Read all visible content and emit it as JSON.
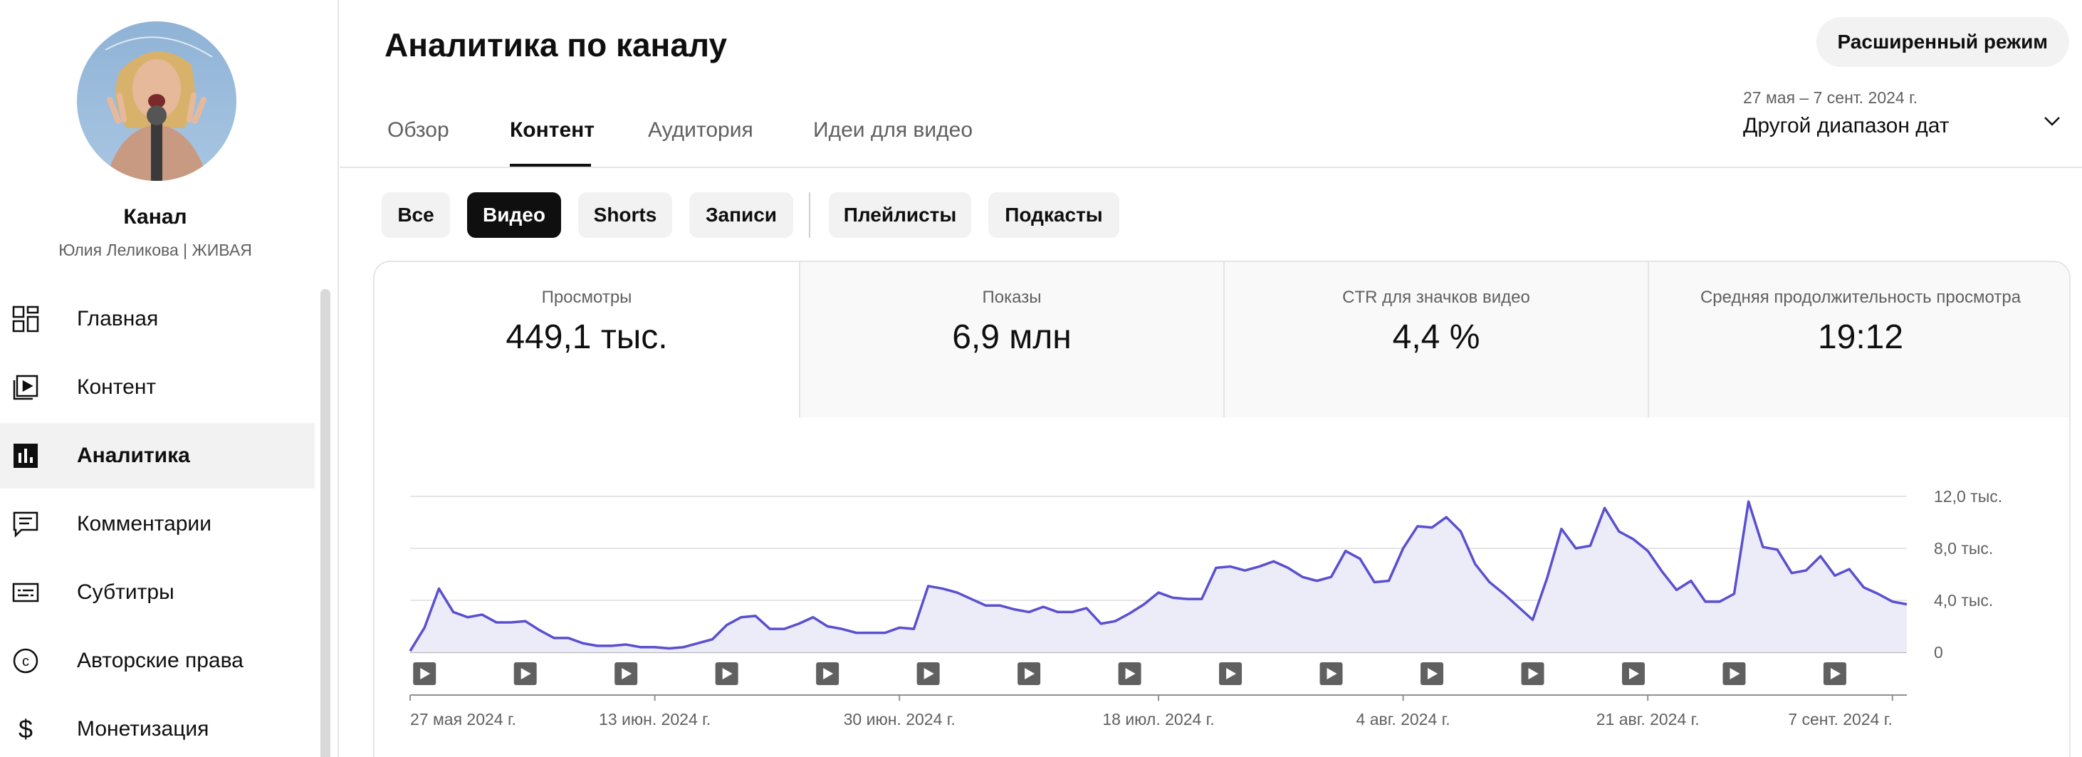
{
  "sidebar": {
    "channel_title": "Канал",
    "channel_name": "Юлия Леликова | ЖИВАЯ",
    "items": [
      {
        "label": "Главная",
        "icon": "dashboard-icon"
      },
      {
        "label": "Контент",
        "icon": "content-icon"
      },
      {
        "label": "Аналитика",
        "icon": "analytics-icon",
        "active": true
      },
      {
        "label": "Комментарии",
        "icon": "comments-icon"
      },
      {
        "label": "Субтитры",
        "icon": "subtitles-icon"
      },
      {
        "label": "Авторские права",
        "icon": "copyright-icon"
      },
      {
        "label": "Монетизация",
        "icon": "monetization-icon"
      }
    ]
  },
  "header": {
    "title": "Аналитика по каналу",
    "advanced_button": "Расширенный режим",
    "tabs": [
      {
        "label": "Обзор"
      },
      {
        "label": "Контент",
        "active": true
      },
      {
        "label": "Аудитория"
      },
      {
        "label": "Идеи для видео"
      }
    ],
    "date_range": {
      "subtitle": "27 мая – 7 сент. 2024 г.",
      "label": "Другой диапазон дат"
    }
  },
  "chips": [
    {
      "label": "Все"
    },
    {
      "label": "Видео",
      "active": true
    },
    {
      "label": "Shorts"
    },
    {
      "label": "Записи"
    },
    {
      "label": "Плейлисты"
    },
    {
      "label": "Подкасты"
    }
  ],
  "metrics": [
    {
      "label": "Просмотры",
      "value": "449,1 тыс.",
      "active": true
    },
    {
      "label": "Показы",
      "value": "6,9 млн"
    },
    {
      "label": "CTR для значков видео",
      "value": "4,4 %"
    },
    {
      "label": "Средняя продолжительность просмотра",
      "value": "19:12"
    }
  ],
  "colors": {
    "accent_line": "#5a4fcf",
    "fill": "#ecebf8"
  },
  "chart_data": {
    "type": "area",
    "y_tick_labels": [
      "12,0 тыс.",
      "8,0 тыс.",
      "4,0 тыс.",
      "0"
    ],
    "y_ticks": [
      12000,
      8000,
      4000,
      0
    ],
    "ylim": [
      0,
      12000
    ],
    "x_tick_labels": [
      "27 мая 2024 г.",
      "13 июн. 2024 г.",
      "30 июн. 2024 г.",
      "18 июл. 2024 г.",
      "4 авг. 2024 г.",
      "21 авг. 2024 г.",
      "7 сент. 2024 г."
    ],
    "x_tick_days": [
      0,
      17,
      34,
      52,
      69,
      86,
      103
    ],
    "upload_marker_days": [
      1,
      8,
      15,
      22,
      29,
      36,
      43,
      50,
      57,
      64,
      71,
      78,
      85,
      92,
      99
    ],
    "grid": true,
    "series": [
      {
        "values": [
          100,
          1900,
          4900,
          3100,
          2700,
          2900,
          2300,
          2300,
          2400,
          1700,
          1100,
          1100,
          700,
          500,
          500,
          600,
          400,
          400,
          300,
          400,
          700,
          1000,
          2100,
          2700,
          2800,
          1800,
          1800,
          2200,
          2700,
          2000,
          1800,
          1500,
          1500,
          1500,
          1900,
          1800,
          5100,
          4900,
          4600,
          4100,
          3600,
          3600,
          3300,
          3100,
          3500,
          3100,
          3100,
          3400,
          2200,
          2400,
          3000,
          3700,
          4600,
          4200,
          4100,
          4100,
          6500,
          6600,
          6300,
          6600,
          7000,
          6500,
          5800,
          5500,
          5800,
          7800,
          7200,
          5400,
          5500,
          8000,
          9700,
          9600,
          10400,
          9300,
          6800,
          5400,
          4500,
          3500,
          2500,
          5700,
          9500,
          8000,
          8200,
          11100,
          9300,
          8700,
          7800,
          6200,
          4800,
          5500,
          3900,
          3900,
          4500,
          11600,
          8100,
          7900,
          6100,
          6300,
          7400,
          5900,
          6400,
          5000,
          4500,
          3900,
          3700
        ]
      }
    ]
  }
}
